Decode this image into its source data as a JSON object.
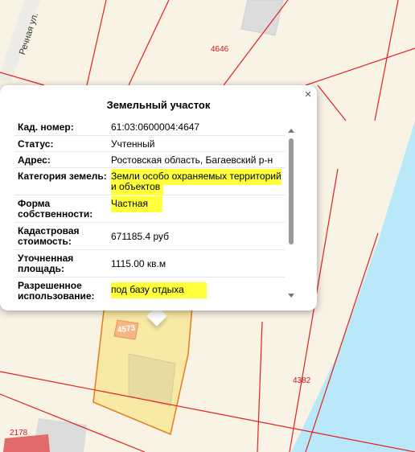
{
  "map": {
    "street_name": "Речная ул.",
    "parcel_labels": [
      "4646",
      "4573",
      "4382",
      "2178"
    ],
    "water_color": "#b9e8f8",
    "boundary_color": "#e32020",
    "selected_fill": "#f8e9a4"
  },
  "popup": {
    "title": "Земельный участок",
    "close_icon": "×",
    "rows": [
      {
        "label": "Кад. номер:",
        "value": "61:03:0600004:4647",
        "highlight": false
      },
      {
        "label": "Статус:",
        "value": "Учтенный",
        "highlight": false
      },
      {
        "label": "Адрес:",
        "value": "Ростовская область, Багаевский р-н",
        "highlight": false
      },
      {
        "label": "Категория земель:",
        "value": "Земли особо охраняемых территорий и объектов",
        "highlight": true
      },
      {
        "label": "Форма собственности:",
        "value": "Частная",
        "highlight": true
      },
      {
        "label": "Кадастровая стоимость:",
        "value": "671185.4 руб",
        "highlight": false
      },
      {
        "label": "Уточненная площадь:",
        "value": "1115.00 кв.м",
        "highlight": false
      },
      {
        "label": "Разрешенное использование:",
        "value": "под базу отдыха",
        "highlight": true
      }
    ]
  }
}
